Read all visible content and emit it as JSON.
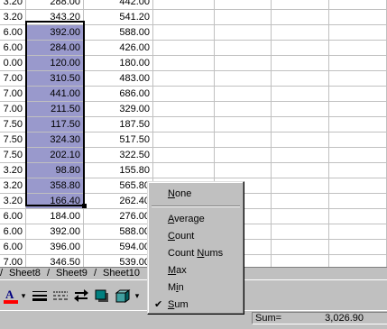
{
  "grid": {
    "rows": [
      {
        "a": "3.20",
        "b": "288.00",
        "c": "442.00"
      },
      {
        "a": "3.20",
        "b": "343.20",
        "c": "541.20"
      },
      {
        "a": "6.00",
        "b": "392.00",
        "c": "588.00"
      },
      {
        "a": "6.00",
        "b": "284.00",
        "c": "426.00"
      },
      {
        "a": "0.00",
        "b": "120.00",
        "c": "180.00"
      },
      {
        "a": "7.00",
        "b": "310.50",
        "c": "483.00"
      },
      {
        "a": "7.00",
        "b": "441.00",
        "c": "686.00"
      },
      {
        "a": "7.00",
        "b": "211.50",
        "c": "329.00"
      },
      {
        "a": "7.50",
        "b": "117.50",
        "c": "187.50"
      },
      {
        "a": "7.50",
        "b": "324.30",
        "c": "517.50"
      },
      {
        "a": "7.50",
        "b": "202.10",
        "c": "322.50"
      },
      {
        "a": "3.20",
        "b": "98.80",
        "c": "155.80"
      },
      {
        "a": "3.20",
        "b": "358.80",
        "c": "565.80"
      },
      {
        "a": "3.20",
        "b": "166.40",
        "c": "262.40"
      },
      {
        "a": "6.00",
        "b": "184.00",
        "c": "276.00"
      },
      {
        "a": "6.00",
        "b": "392.00",
        "c": "588.00"
      },
      {
        "a": "6.00",
        "b": "396.00",
        "c": "594.00"
      },
      {
        "a": "7.00",
        "b": "346.50",
        "c": "539.00"
      }
    ]
  },
  "tabs": [
    "Sheet8",
    "Sheet9",
    "Sheet10"
  ],
  "menu": {
    "items": [
      {
        "label": "None",
        "accel": "N",
        "checked": false
      },
      {
        "label": "Average",
        "accel": "A",
        "checked": false
      },
      {
        "label": "Count",
        "accel": "C",
        "checked": false
      },
      {
        "label": "Count Nums",
        "accel": "N",
        "checked": false
      },
      {
        "label": "Max",
        "accel": "M",
        "checked": false
      },
      {
        "label": "Min",
        "accel": "i",
        "checked": false
      },
      {
        "label": "Sum",
        "accel": "S",
        "checked": true
      }
    ],
    "check_glyph": "✔"
  },
  "status": {
    "sum_label": "Sum=",
    "sum_value": "3,026.90"
  },
  "toolbar": {
    "font_color_letter": "A",
    "font_color_accent": "#ff0000",
    "dropdown_glyph": "▾",
    "tools": [
      "font-color-icon",
      "line-style-icon",
      "dash-style-icon",
      "arrow-style-icon",
      "shadow-icon",
      "3d-icon"
    ]
  }
}
